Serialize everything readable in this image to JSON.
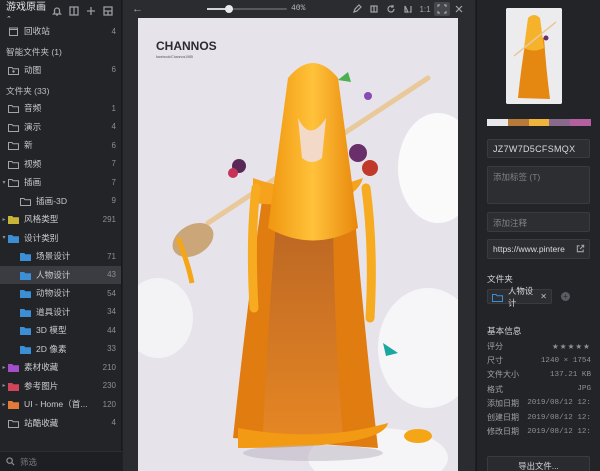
{
  "sidebar": {
    "library": "游戏原画",
    "trash": {
      "label": "回收站",
      "count": "4"
    },
    "smart_header": "智能文件夹 (1)",
    "smart_items": [
      {
        "label": "动图",
        "count": "6"
      }
    ],
    "folders_header": "文件夹 (33)",
    "folders": [
      {
        "label": "音频",
        "count": "1",
        "indent": 0,
        "color": "#a4a5a9",
        "arrow": ""
      },
      {
        "label": "演示",
        "count": "4",
        "indent": 0,
        "color": "#a4a5a9",
        "arrow": ""
      },
      {
        "label": "新",
        "count": "6",
        "indent": 0,
        "color": "#a4a5a9",
        "arrow": ""
      },
      {
        "label": "视频",
        "count": "7",
        "indent": 0,
        "color": "#a4a5a9",
        "arrow": ""
      },
      {
        "label": "插画",
        "count": "7",
        "indent": 0,
        "color": "#a4a5a9",
        "arrow": "▾"
      },
      {
        "label": "插画-3D",
        "count": "9",
        "indent": 1,
        "color": "#a4a5a9",
        "arrow": ""
      },
      {
        "label": "风格类型",
        "count": "291",
        "indent": 0,
        "color": "#c9b43a",
        "arrow": "▸"
      },
      {
        "label": "设计类别",
        "count": "",
        "indent": 0,
        "color": "#3b8fd6",
        "arrow": "▾"
      },
      {
        "label": "场景设计",
        "count": "71",
        "indent": 1,
        "color": "#3b8fd6",
        "arrow": ""
      },
      {
        "label": "人物设计",
        "count": "43",
        "indent": 1,
        "color": "#3b8fd6",
        "arrow": ""
      },
      {
        "label": "动物设计",
        "count": "54",
        "indent": 1,
        "color": "#3b8fd6",
        "arrow": ""
      },
      {
        "label": "道具设计",
        "count": "34",
        "indent": 1,
        "color": "#3b8fd6",
        "arrow": ""
      },
      {
        "label": "3D 模型",
        "count": "44",
        "indent": 1,
        "color": "#3b8fd6",
        "arrow": ""
      },
      {
        "label": "2D 像素",
        "count": "33",
        "indent": 1,
        "color": "#3b8fd6",
        "arrow": ""
      },
      {
        "label": "素材收藏",
        "count": "210",
        "indent": 0,
        "color": "#a44fc9",
        "arrow": "▸"
      },
      {
        "label": "参考图片",
        "count": "230",
        "indent": 0,
        "color": "#d1455b",
        "arrow": "▸"
      },
      {
        "label": "UI - Home（首...",
        "count": "120",
        "indent": 0,
        "color": "#e07b39",
        "arrow": "▸"
      },
      {
        "label": "站酷收藏",
        "count": "4",
        "indent": 0,
        "color": "#a4a5a9",
        "arrow": ""
      }
    ],
    "selected_folder": "人物设计",
    "search_placeholder": "筛选"
  },
  "toolbar": {
    "zoom": "40%",
    "ratio": "1:1",
    "zoom_fraction": 0.26
  },
  "image": {
    "logo_text": "CHANNOS",
    "logo_sub": "facebook/Channos1985"
  },
  "inspector": {
    "swatches": [
      "#e8e8ea",
      "#b87a3a",
      "#f0b43c",
      "#8a6a8c",
      "#b45fa0"
    ],
    "id": "JZ7W7D5CFSMQX",
    "tag_placeholder": "添加标签 (T)",
    "note_placeholder": "添加注释",
    "url": "https://www.pintere",
    "folder_label": "文件夹",
    "folder_chip": "人物设计",
    "info_label": "基本信息",
    "info": [
      {
        "k": "评分",
        "v": "★★★★★"
      },
      {
        "k": "尺寸",
        "v": "1240 × 1754"
      },
      {
        "k": "文件大小",
        "v": "137.21 KB"
      },
      {
        "k": "格式",
        "v": "JPG"
      },
      {
        "k": "添加日期",
        "v": "2019/08/12 12:"
      },
      {
        "k": "创建日期",
        "v": "2019/08/12 12:"
      },
      {
        "k": "修改日期",
        "v": "2019/08/12 12:"
      }
    ],
    "export": "导出文件..."
  }
}
